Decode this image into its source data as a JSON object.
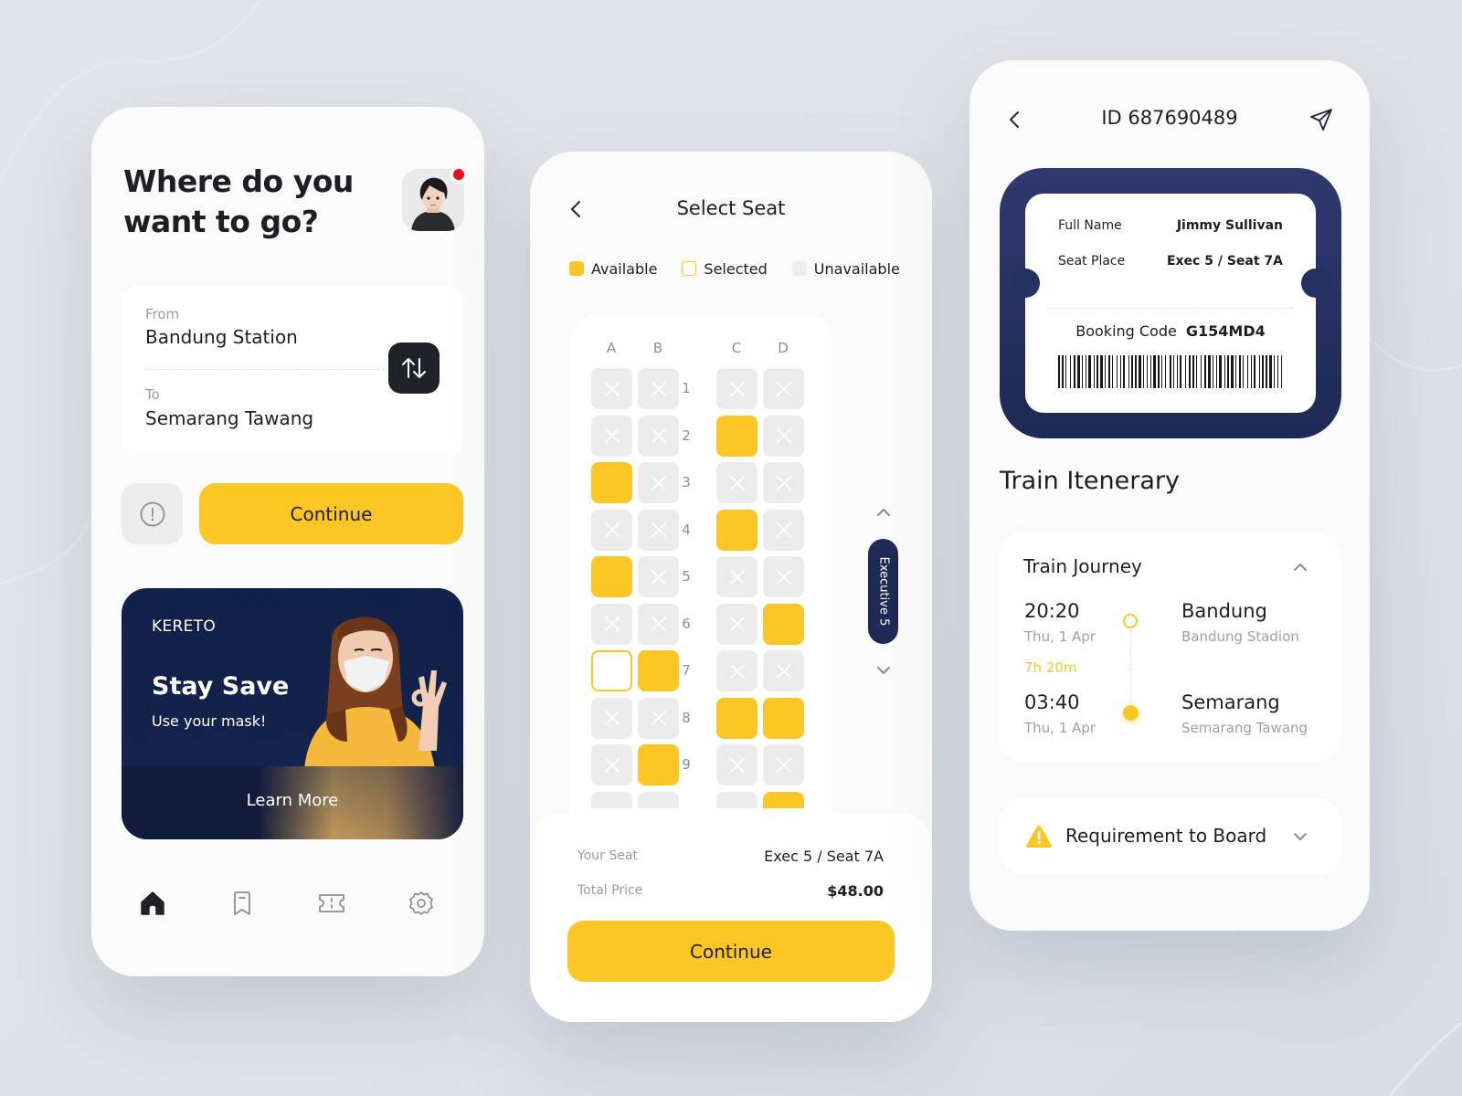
{
  "home": {
    "title": "Where do you want to go?",
    "avatar_alt": "user-avatar",
    "has_notification": true,
    "route": {
      "from_label": "From",
      "from_value": "Bandung Station",
      "to_label": "To",
      "to_value": "Semarang Tawang"
    },
    "continue_label": "Continue",
    "promo": {
      "brand": "KERETO",
      "title": "Stay Save",
      "subtitle": "Use your mask!",
      "cta": "Learn More"
    },
    "nav": [
      {
        "name": "home",
        "icon": "home-icon",
        "active": true
      },
      {
        "name": "saved",
        "icon": "bookmark-icon",
        "active": false
      },
      {
        "name": "tickets",
        "icon": "ticket-icon",
        "active": false
      },
      {
        "name": "settings",
        "icon": "gear-icon",
        "active": false
      }
    ]
  },
  "seat": {
    "title": "Select Seat",
    "legend": [
      {
        "key": "available",
        "label": "Available"
      },
      {
        "key": "selected",
        "label": "Selected"
      },
      {
        "key": "unavailable",
        "label": "Unavailable"
      }
    ],
    "columns": [
      "A",
      "B",
      "C",
      "D"
    ],
    "rows": [
      {
        "number": "1",
        "seats": [
          "unavailable",
          "unavailable",
          "unavailable",
          "unavailable"
        ]
      },
      {
        "number": "2",
        "seats": [
          "unavailable",
          "unavailable",
          "available",
          "unavailable"
        ]
      },
      {
        "number": "3",
        "seats": [
          "available",
          "unavailable",
          "unavailable",
          "unavailable"
        ]
      },
      {
        "number": "4",
        "seats": [
          "unavailable",
          "unavailable",
          "available",
          "unavailable"
        ]
      },
      {
        "number": "5",
        "seats": [
          "available",
          "unavailable",
          "unavailable",
          "unavailable"
        ]
      },
      {
        "number": "6",
        "seats": [
          "unavailable",
          "unavailable",
          "unavailable",
          "available"
        ]
      },
      {
        "number": "7",
        "seats": [
          "selected",
          "available",
          "unavailable",
          "unavailable"
        ]
      },
      {
        "number": "8",
        "seats": [
          "unavailable",
          "unavailable",
          "available",
          "available"
        ]
      },
      {
        "number": "9",
        "seats": [
          "unavailable",
          "available",
          "unavailable",
          "unavailable"
        ]
      },
      {
        "number": "",
        "seats": [
          "unavailable",
          "unavailable",
          "unavailable",
          "available"
        ]
      }
    ],
    "car_label": "Executive 5",
    "summary": {
      "seat_label": "Your Seat",
      "seat_value": "Exec 5 / Seat 7A",
      "price_label": "Total Price",
      "price_value": "$48.00"
    },
    "continue_label": "Continue"
  },
  "ticket": {
    "title": "ID 687690489",
    "full_name_label": "Full Name",
    "full_name_value": "Jimmy Sullivan",
    "seat_label": "Seat Place",
    "seat_value": "Exec 5 / Seat 7A",
    "booking_label": "Booking Code",
    "booking_value": "G154MD4",
    "itinerary_title": "Train Itenerary",
    "journey": {
      "heading": "Train Journey",
      "depart_time": "20:20",
      "depart_date": "Thu, 1 Apr",
      "duration": "7h 20m",
      "arrive_time": "03:40",
      "arrive_date": "Thu, 1 Apr",
      "depart_city": "Bandung",
      "depart_station": "Bandung Stadion",
      "arrive_city": "Semarang",
      "arrive_station": "Semarang Tawang"
    },
    "requirement_label": "Requirement to Board"
  },
  "colors": {
    "accent": "#fcc624",
    "dark": "#1f2229",
    "navy": "#1e2a55",
    "unavailable": "#ebebec",
    "notification": "#e8101c"
  }
}
